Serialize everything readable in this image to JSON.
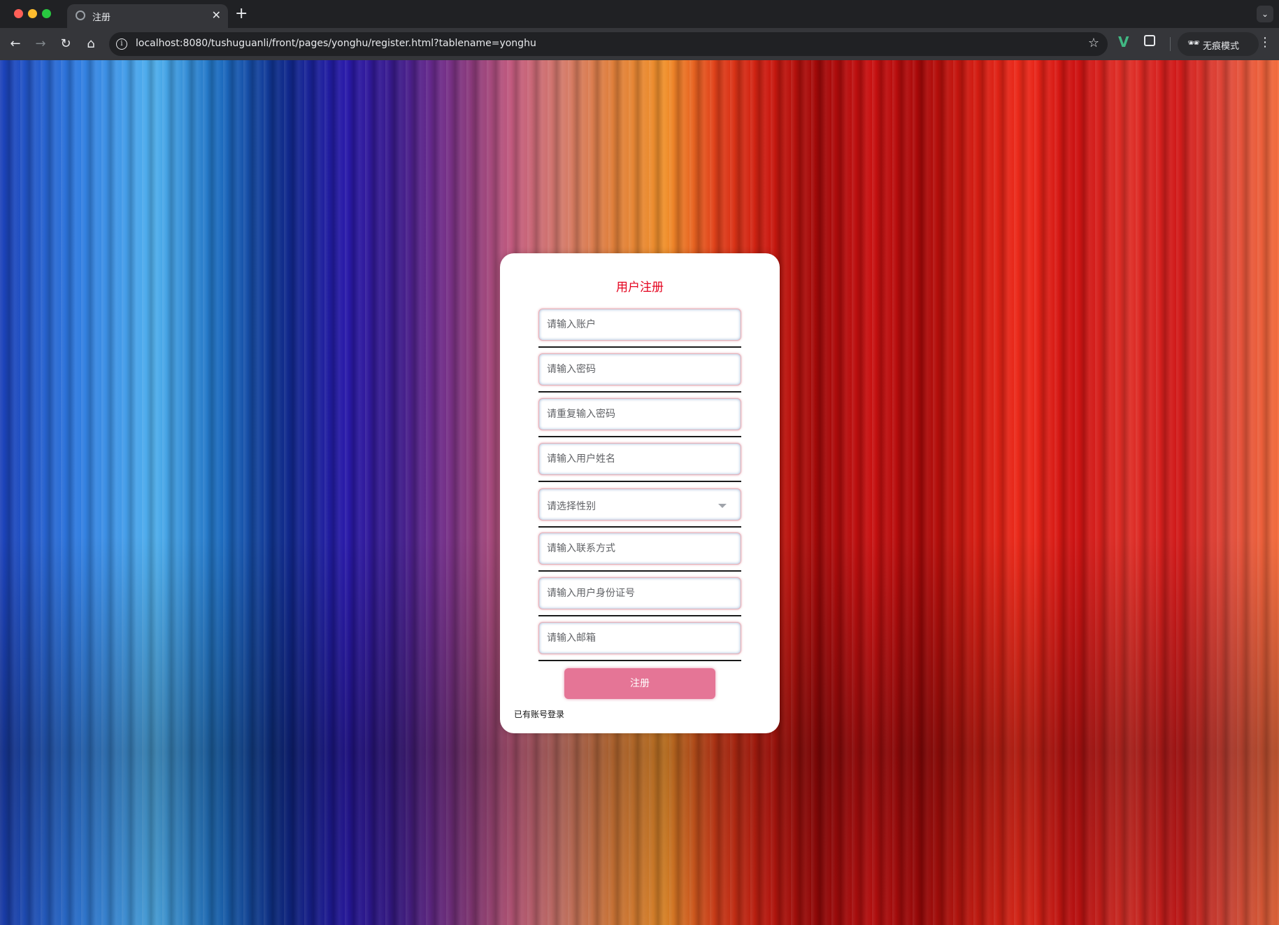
{
  "browser": {
    "tab_title": "注册",
    "url": "localhost:8080/tushuguanli/front/pages/yonghu/register.html?tablename=yonghu",
    "incognito_label": "无痕模式"
  },
  "form": {
    "title": "用户注册",
    "fields": [
      {
        "placeholder": "请输入账户"
      },
      {
        "placeholder": "请输入密码"
      },
      {
        "placeholder": "请重复输入密码"
      },
      {
        "placeholder": "请输入用户姓名"
      },
      {
        "placeholder": "请选择性别",
        "type": "select"
      },
      {
        "placeholder": "请输入联系方式"
      },
      {
        "placeholder": "请输入用户身份证号"
      },
      {
        "placeholder": "请输入邮箱"
      }
    ],
    "submit_label": "注册",
    "login_link": "已有账号登录"
  },
  "colors": {
    "title": "#e4001c",
    "button": "#e57596"
  }
}
